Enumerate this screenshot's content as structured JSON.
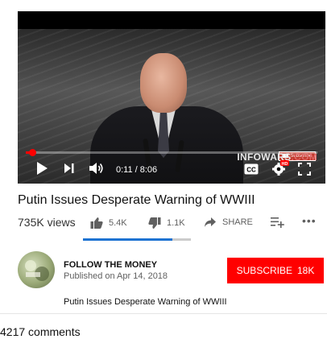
{
  "video": {
    "watermark_main": "INFOWARS",
    "watermark_tld": ".COM",
    "subscribe_chip": "Subscribe",
    "time": "0:11 / 8:06",
    "progress": 0.023,
    "cc_label": "CC",
    "hd_badge": "HD",
    "icons": [
      "play-icon",
      "next-icon",
      "volume-icon",
      "captions-icon",
      "settings-icon",
      "fullscreen-icon"
    ]
  },
  "info": {
    "title": "Putin Issues Desperate Warning of WWIII",
    "views": "735K views",
    "likes": "5.4K",
    "dislikes": "1.1K",
    "share": "SHARE",
    "like_ratio": 0.83
  },
  "channel": {
    "name": "FOLLOW THE MONEY",
    "published": "Published on Apr 14, 2018",
    "subscribe_label": "SUBSCRIBE",
    "subscriber_count": "18K",
    "description": "Putin Issues Desperate Warning of WWIII"
  },
  "comments": {
    "count_label": "4217 comments"
  },
  "colors": {
    "accent": "#ff0000",
    "like_bar": "#1e73d2"
  }
}
